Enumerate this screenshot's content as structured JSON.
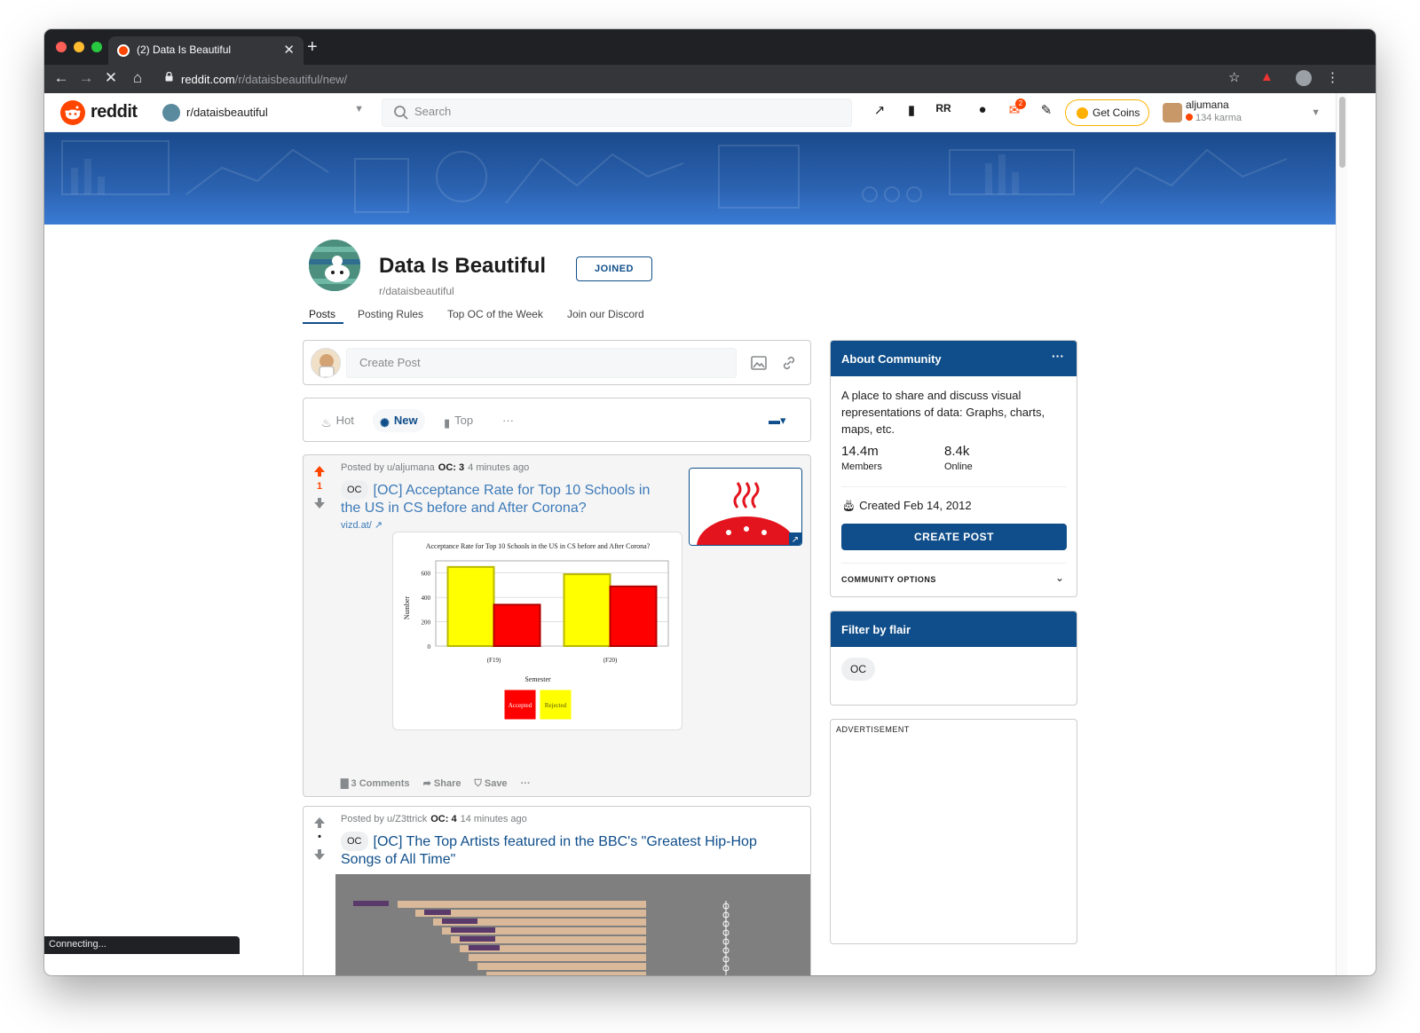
{
  "browser": {
    "tab_title": "(2) Data Is Beautiful",
    "tab_close": "✕",
    "new_tab": "+",
    "url_host": "reddit.com",
    "url_path": "/r/dataisbeautiful/new/",
    "status_text": "Connecting..."
  },
  "header": {
    "logo_text": "reddit",
    "community_selector": "r/dataisbeautiful",
    "search_placeholder": "Search",
    "coins_label": "Get Coins",
    "mail_badge": "2",
    "username": "aljumana",
    "karma": "134 karma"
  },
  "community": {
    "title": "Data Is Beautiful",
    "name": "r/dataisbeautiful",
    "join_label": "JOINED",
    "tabs": [
      "Posts",
      "Posting Rules",
      "Top OC of the Week",
      "Join our Discord"
    ]
  },
  "create_post": {
    "placeholder": "Create Post"
  },
  "sort": {
    "items": [
      "Hot",
      "New",
      "Top"
    ],
    "more": "···",
    "active": "New"
  },
  "posts": [
    {
      "meta_prefix": "Posted by u/aljumana",
      "flair": "OC: 3",
      "time": "4 minutes ago",
      "votes": "1",
      "tag": "OC",
      "title": "[OC] Acceptance Rate for Top 10 Schools in the US in CS before and After Corona?",
      "link": "vizd.at/",
      "comments": "3 Comments",
      "share": "Share",
      "save": "Save",
      "more": "···"
    },
    {
      "meta_prefix": "Posted by u/Z3ttrick",
      "flair": "OC: 4",
      "time": "14 minutes ago",
      "votes": "•",
      "tag": "OC",
      "title": "[OC] The Top Artists featured in the BBC's \"Greatest Hip-Hop Songs of All Time\""
    }
  ],
  "chart_data": {
    "type": "bar",
    "title": "Acceptance Rate for Top 10 Schools in the US in CS before and After Corona?",
    "xlabel": "Semester",
    "ylabel": "Number",
    "categories": [
      "(F19)",
      "(F20)"
    ],
    "series": [
      {
        "name": "Rejected",
        "values": [
          650,
          590
        ],
        "color": "#ffff00"
      },
      {
        "name": "Accepted",
        "values": [
          340,
          490
        ],
        "color": "#ff0000"
      }
    ],
    "ylim": [
      0,
      700
    ],
    "yticks": [
      "0",
      "200",
      "400",
      "600"
    ],
    "legend": "bottom"
  },
  "sidebar": {
    "about_title": "About Community",
    "more": "···",
    "description": "A place to share and discuss visual representations of data: Graphs, charts, maps, etc.",
    "members_value": "14.4m",
    "members_label": "Members",
    "online_value": "8.4k",
    "online_label": "Online",
    "created": "Created Feb 14, 2012",
    "create_post_label": "CREATE POST",
    "community_options": "COMMUNITY OPTIONS",
    "filter_title": "Filter by flair",
    "flair_pill": "OC",
    "ad_label": "ADVERTISEMENT"
  },
  "colors": {
    "accent": "#0f4e8a",
    "upvote": "#ff4500",
    "chrome_dark": "#202124"
  }
}
